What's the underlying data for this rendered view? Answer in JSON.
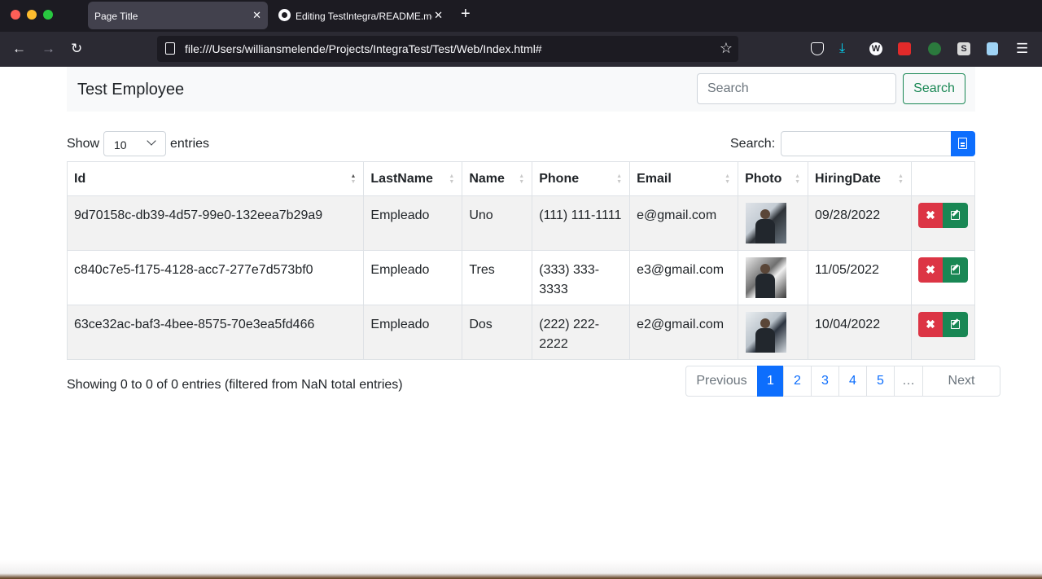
{
  "browser": {
    "tabs": [
      {
        "title": "Page Title",
        "active": true
      },
      {
        "title": "Editing TestIntegra/README.md",
        "active": false
      }
    ],
    "url": "file:///Users/williansmelende/Projects/IntegraTest/Test/Web/Index.html#"
  },
  "app": {
    "brand": "Test Employee",
    "search_placeholder": "Search",
    "search_button": "Search"
  },
  "table_controls": {
    "show_label": "Show",
    "page_length": "10",
    "entries_label": "entries",
    "filter_label": "Search:"
  },
  "columns": [
    "Id",
    "LastName",
    "Name",
    "Phone",
    "Email",
    "Photo",
    "HiringDate",
    ""
  ],
  "rows": [
    {
      "id": "9d70158c-db39-4d57-99e0-132eea7b29a9",
      "lastname": "Empleado",
      "name": "Uno",
      "phone": "(111) 111-1111",
      "email": "e@gmail.com",
      "photo": "employee-photo",
      "hiring_date": "09/28/2022"
    },
    {
      "id": "c840c7e5-f175-4128-acc7-277e7d573bf0",
      "lastname": "Empleado",
      "name": "Tres",
      "phone": "(333) 333-3333",
      "email": "e3@gmail.com",
      "photo": "employee-photo",
      "hiring_date": "11/05/2022"
    },
    {
      "id": "63ce32ac-baf3-4bee-8575-70e3ea5fd466",
      "lastname": "Empleado",
      "name": "Dos",
      "phone": "(222) 222-2222",
      "email": "e2@gmail.com",
      "photo": "employee-photo",
      "hiring_date": "10/04/2022"
    }
  ],
  "row_actions": {
    "delete_icon": "✖",
    "edit_icon": "edit-icon"
  },
  "info": "Showing 0 to 0 of 0 entries (filtered from NaN total entries)",
  "pagination": {
    "previous": "Previous",
    "pages": [
      "1",
      "2",
      "3",
      "4",
      "5"
    ],
    "ellipsis": "…",
    "next": "Next",
    "current": "1"
  },
  "colors": {
    "primary": "#0d6efd",
    "success": "#198754",
    "danger": "#dc3545"
  }
}
